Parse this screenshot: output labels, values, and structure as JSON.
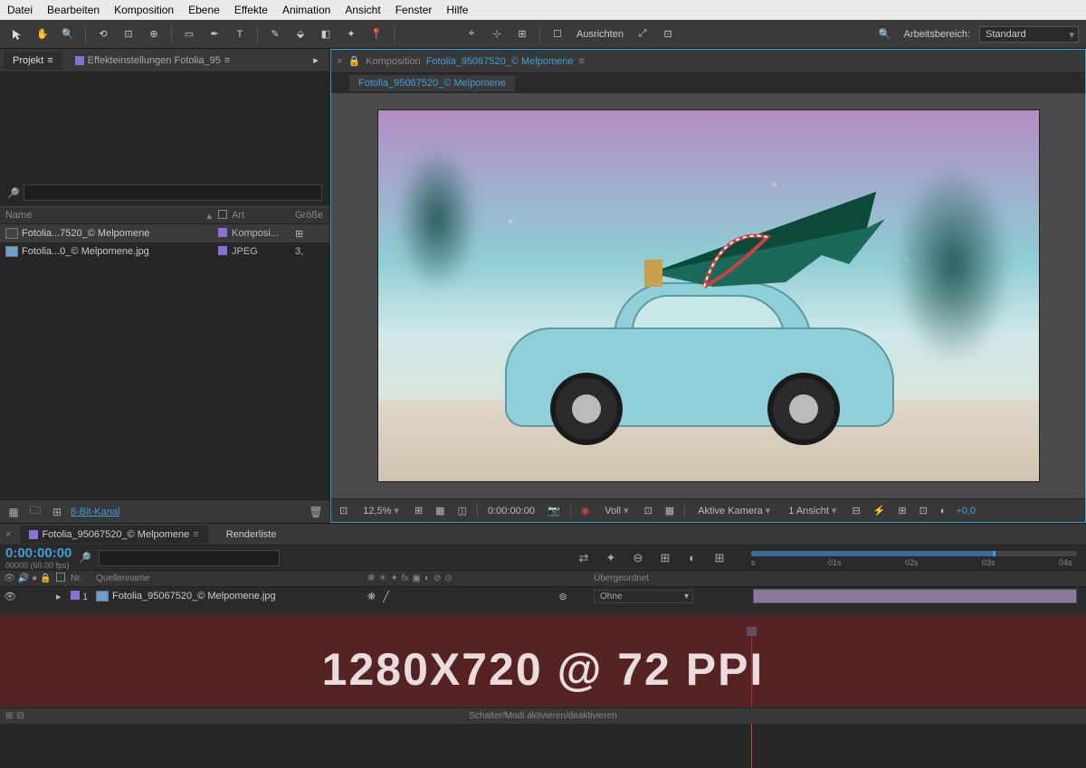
{
  "menu": {
    "items": [
      "Datei",
      "Bearbeiten",
      "Komposition",
      "Ebene",
      "Effekte",
      "Animation",
      "Ansicht",
      "Fenster",
      "Hilfe"
    ]
  },
  "toolbar": {
    "align_label": "Ausrichten",
    "workspace_label": "Arbeitsbereich:",
    "workspace_value": "Standard"
  },
  "project": {
    "tab_project": "Projekt",
    "tab_effects": "Effekteinstellungen Fotolia_95",
    "search_placeholder": "",
    "columns": {
      "name": "Name",
      "type": "Art",
      "size": "Größe"
    },
    "items": [
      {
        "name": "Fotolia...7520_© Melpomene",
        "type": "Komposi...",
        "size": "",
        "icon": "comp"
      },
      {
        "name": "Fotolia...0_© Melpomene.jpg",
        "type": "JPEG",
        "size": "3,",
        "icon": "jpg"
      }
    ],
    "bit_depth": "8-Bit-Kanal"
  },
  "composition": {
    "header_label": "Komposition",
    "header_name": "Fotolia_95067520_© Melpomene",
    "subtab": "Fotolia_95067520_© Melpomene"
  },
  "viewer_bar": {
    "zoom": "12,5%",
    "timecode": "0:00:00:00",
    "quality": "Voll",
    "camera": "Aktive Kamera",
    "views": "1 Ansicht",
    "exposure": "+0,0"
  },
  "timeline": {
    "tab_active": "Fotolia_95067520_© Melpomene",
    "tab_render": "Renderliste",
    "timecode": "0:00:00:00",
    "fps": "00000 (60.00 fps)",
    "cols": {
      "nr": "Nr.",
      "src": "Quellenname",
      "parent": "Übergeordnet"
    },
    "layer": {
      "nr": "1",
      "name": "Fotolia_95067520_© Melpomene.jpg",
      "parent": "Ohne"
    },
    "ruler": [
      "s",
      "01s",
      "02s",
      "03s",
      "04s"
    ]
  },
  "overlay": {
    "text": "1280X720 @ 72 PPI"
  },
  "statusbar": {
    "hint": "Schalter/Modi aktivieren/deaktivieren"
  }
}
